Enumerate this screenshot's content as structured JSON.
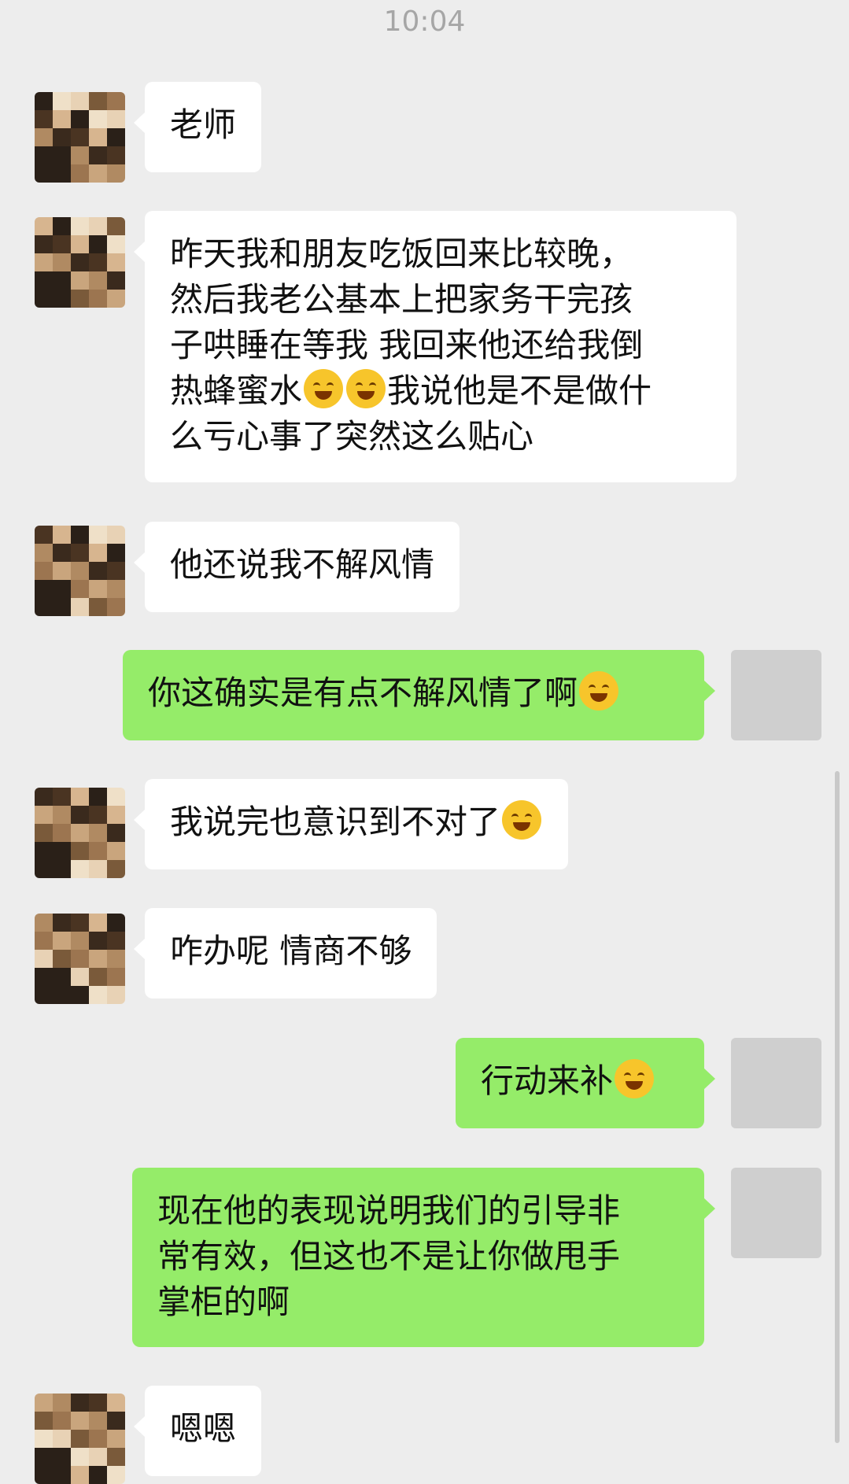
{
  "status_bar": {
    "time": "10:04"
  },
  "messages": [
    {
      "sender": "other",
      "text": "老师"
    },
    {
      "sender": "other",
      "text_lines": [
        "昨天我和朋友吃饭回来比较晚，",
        "然后我老公基本上把家务干完孩",
        "子哄睡在等我 我回来他还给我倒"
      ],
      "text_tail_before": "热蜂蜜水",
      "text_tail_after": "我说他是不是做什",
      "text_last": "么亏心事了突然这么贴心",
      "emojis": [
        "laughing-tears-emoji",
        "laughing-tears-emoji"
      ]
    },
    {
      "sender": "other",
      "text": "他还说我不解风情"
    },
    {
      "sender": "me",
      "text": "你这确实是有点不解风情了啊",
      "emoji": "embarrassed-emoji"
    },
    {
      "sender": "other",
      "text": "我说完也意识到不对了",
      "emoji": "facepalm-emoji"
    },
    {
      "sender": "other",
      "text": "咋办呢 情商不够"
    },
    {
      "sender": "me",
      "text": "行动来补",
      "emoji": "thinking-emoji"
    },
    {
      "sender": "me",
      "text_lines": [
        "现在他的表现说明我们的引导非",
        "常有效，但这也不是让你做甩手",
        "掌柜的啊"
      ]
    },
    {
      "sender": "other",
      "text": "嗯嗯"
    }
  ],
  "colors": {
    "background": "#ededed",
    "incoming_bubble": "#ffffff",
    "outgoing_bubble": "#95ec69"
  }
}
